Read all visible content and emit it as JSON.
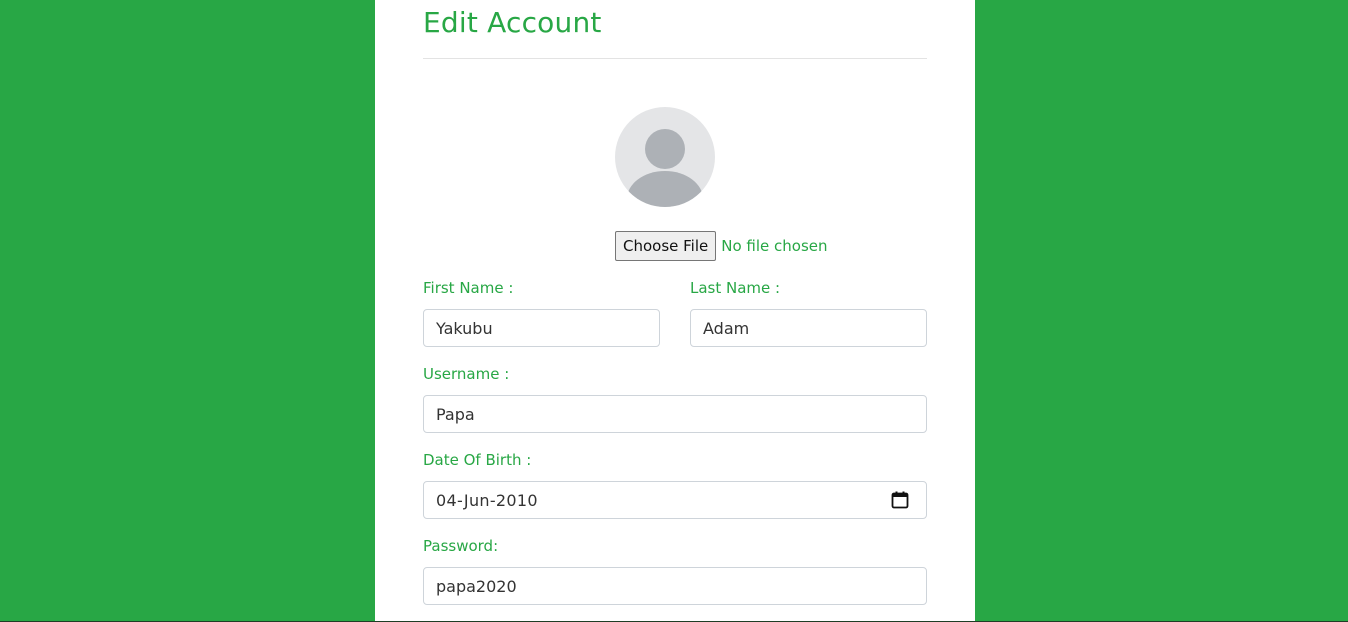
{
  "form": {
    "title": "Edit Account",
    "file_button_label": "Choose File",
    "file_status": "No file chosen",
    "first_name_label": "First Name :",
    "first_name_value": "Yakubu",
    "last_name_label": "Last Name :",
    "last_name_value": "Adam",
    "username_label": "Username :",
    "username_value": "Papa",
    "dob_label": "Date Of Birth :",
    "dob_value": "04-Jun-2010",
    "password_label": "Password:",
    "password_value": "papa2020"
  },
  "icons": {
    "avatar": "user-avatar-placeholder",
    "calendar": "calendar-icon"
  },
  "colors": {
    "background": "#28a745",
    "accent": "#28a745",
    "card": "#ffffff",
    "field_border": "#ced4da"
  }
}
